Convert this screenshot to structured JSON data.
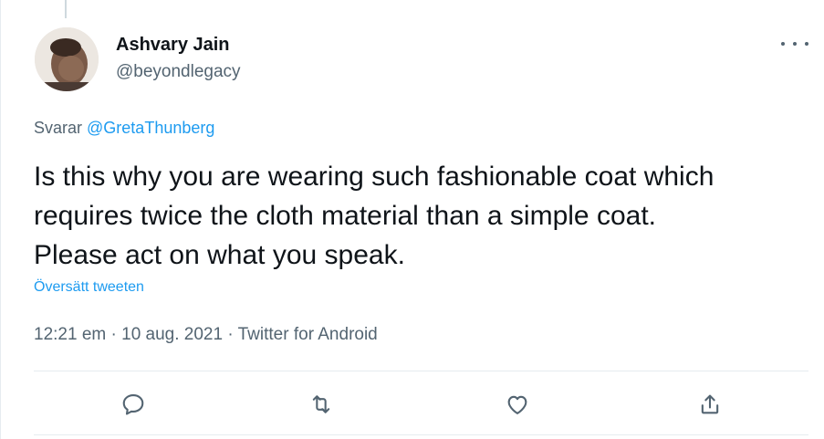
{
  "author": {
    "name": "Ashvary Jain",
    "handle": "@beyondlegacy"
  },
  "reply": {
    "prefix": "Svarar",
    "mention": "@GretaThunberg"
  },
  "tweet": {
    "text": "Is this why you are wearing such fashionable coat which\nrequires twice the cloth material than a simple coat.\nPlease act on what you speak.",
    "translate_label": "Översätt tweeten",
    "time": "12:21 em",
    "date": "10 aug. 2021",
    "source": "Twitter for Android",
    "separator": "·"
  },
  "actions": [
    "reply-icon",
    "retweet-icon",
    "like-icon",
    "share-icon"
  ],
  "colors": {
    "text": "#0f1419",
    "secondary": "#536471",
    "link": "#1d9bf0",
    "border": "#e6ecf0"
  }
}
